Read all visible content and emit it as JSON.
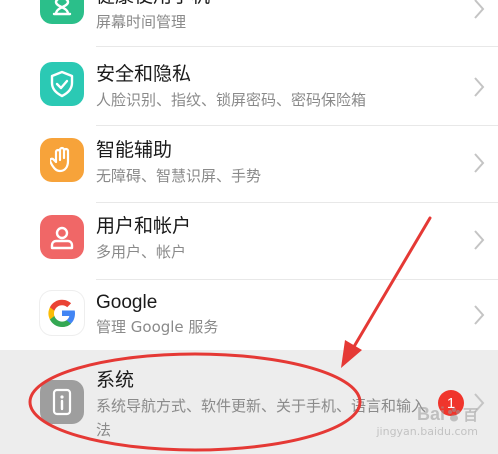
{
  "settings": {
    "items": [
      {
        "title": "健康使用手机",
        "subtitle": "屏幕时间管理",
        "icon": "hourglass-icon",
        "color": "#2bbf8a"
      },
      {
        "title": "安全和隐私",
        "subtitle": "人脸识别、指纹、锁屏密码、密码保险箱",
        "icon": "shield-check-icon",
        "color": "#2bc9b4"
      },
      {
        "title": "智能辅助",
        "subtitle": "无障碍、智慧识屏、手势",
        "icon": "hand-icon",
        "color": "#f7a33a"
      },
      {
        "title": "用户和帐户",
        "subtitle": "多用户、帐户",
        "icon": "user-icon",
        "color": "#f06767"
      },
      {
        "title": "Google",
        "subtitle": "管理 Google 服务",
        "icon": "google-logo-icon",
        "color": "#ffffff"
      },
      {
        "title": "系统",
        "subtitle": "系统导航方式、软件更新、关于手机、语言和输入法",
        "icon": "phone-info-icon",
        "color": "#9e9e9e",
        "badge": "1"
      }
    ]
  },
  "watermark": {
    "logo": "Bai",
    "logo_tail": "百",
    "text": "jingyan.baidu.com"
  },
  "colors": {
    "annotation_red": "#e53935",
    "badge_red": "#f0352c",
    "highlight_bg": "#ededed"
  }
}
